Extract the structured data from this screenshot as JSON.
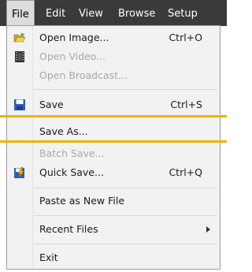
{
  "menubar": {
    "items": [
      {
        "label": "File"
      },
      {
        "label": "Edit"
      },
      {
        "label": "View"
      },
      {
        "label": "Browse"
      },
      {
        "label": "Setup"
      }
    ]
  },
  "file_menu": {
    "open_image": {
      "label": "Open Image...",
      "shortcut": "Ctrl+O",
      "icon": "open-folder-icon"
    },
    "open_video": {
      "label": "Open Video...",
      "icon": "film-icon"
    },
    "open_broadcast": {
      "label": "Open Broadcast..."
    },
    "save": {
      "label": "Save",
      "shortcut": "Ctrl+S",
      "icon": "floppy-disk-icon"
    },
    "save_as": {
      "label": "Save As..."
    },
    "batch_save": {
      "label": "Batch Save..."
    },
    "quick_save": {
      "label": "Quick Save...",
      "shortcut": "Ctrl+Q",
      "icon": "quick-save-icon"
    },
    "paste_new": {
      "label": "Paste as New File"
    },
    "recent_files": {
      "label": "Recent Files"
    },
    "exit": {
      "label": "Exit"
    }
  },
  "colors": {
    "menubar_bg": "#3a3a3a",
    "menu_bg": "#f2f2f2",
    "disabled_text": "#a8a8a8",
    "highlight_line": "#f2b100"
  }
}
